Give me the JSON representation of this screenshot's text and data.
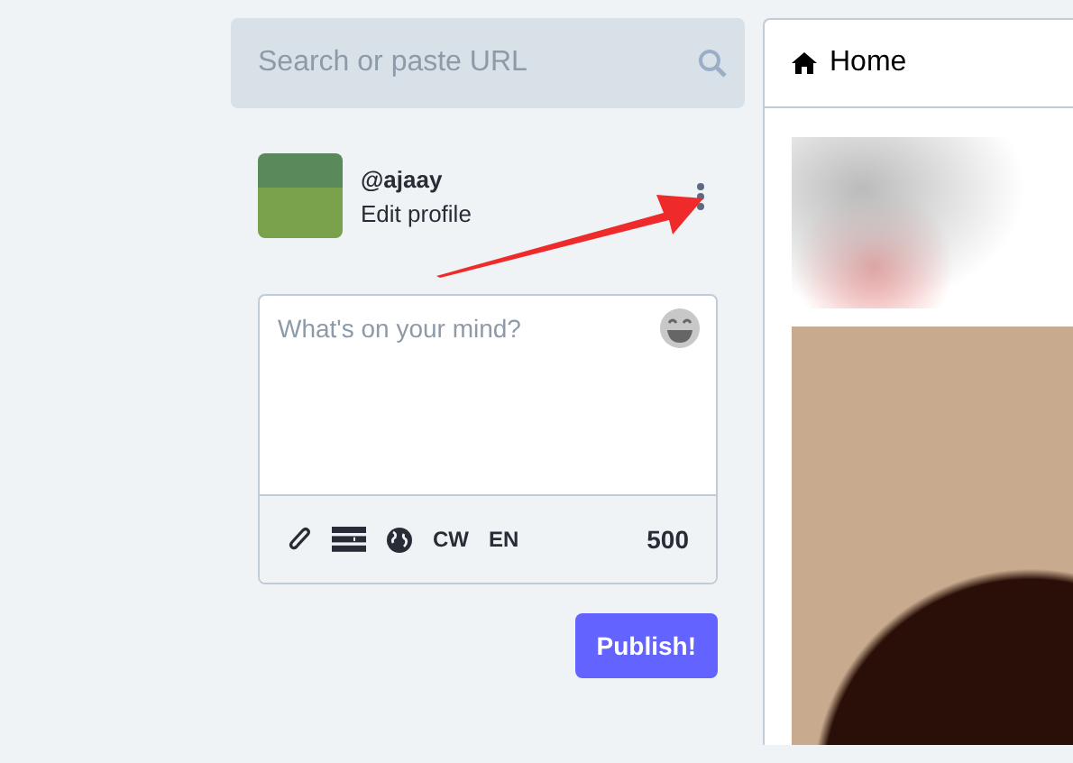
{
  "search": {
    "placeholder": "Search or paste URL"
  },
  "profile": {
    "handle": "@ajaay",
    "edit_link": "Edit profile"
  },
  "compose": {
    "placeholder": "What's on your mind?",
    "tools": [
      "CW",
      "EN"
    ],
    "counter": "500"
  },
  "publish_button": "Publish!",
  "column": {
    "title": "Home"
  }
}
